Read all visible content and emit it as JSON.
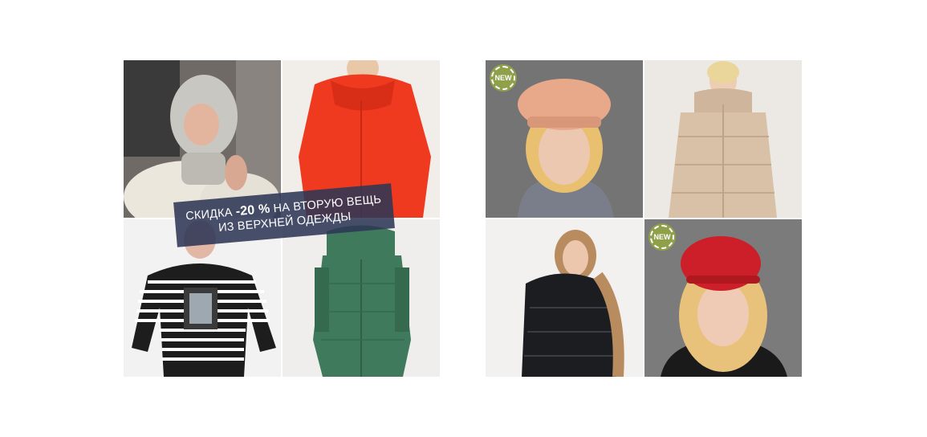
{
  "promo": {
    "line1_start": "СКИДКА",
    "line1_discount": "-20 %",
    "line1_end": "НА ВТОРУЮ ВЕЩЬ",
    "line2": "ИЗ ВЕРХНЕЙ ОДЕЖДЫ"
  },
  "badges": {
    "new": "NEW"
  },
  "icons": {
    "prev": "chevron-left-icon"
  },
  "colors": {
    "banner_bg": "#2d3755",
    "badge_bg": "#8ea14a",
    "red_coat": "#ef3a1f",
    "green_coat": "#3f7a5c",
    "beige_coat": "#d9c1a8",
    "red_beret": "#cc1f29",
    "peach_beret": "#e8a98a"
  }
}
